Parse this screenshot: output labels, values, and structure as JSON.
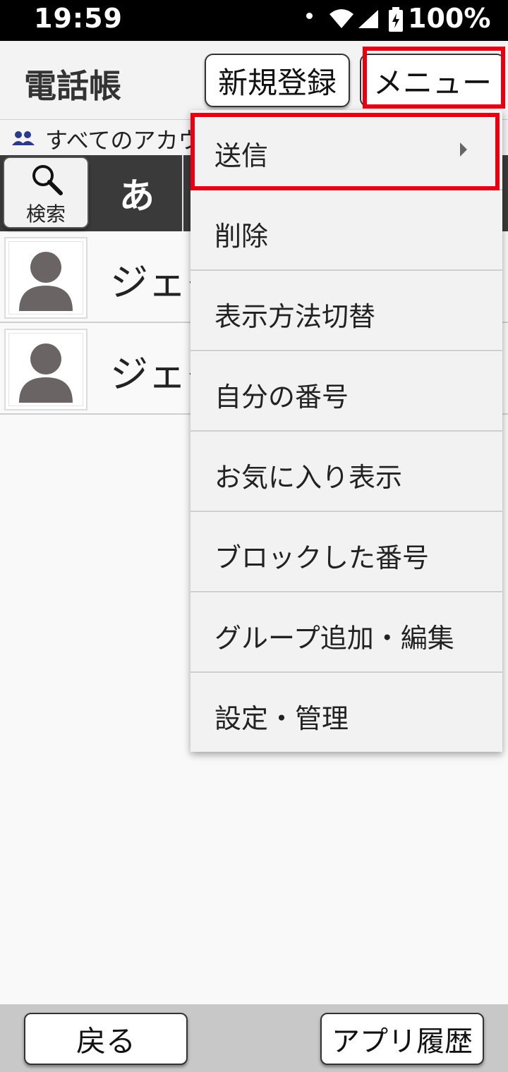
{
  "status": {
    "time": "19:59",
    "battery": "100%"
  },
  "header": {
    "title": "電話帳",
    "new_button": "新規登録",
    "menu_button": "メニュー"
  },
  "account": {
    "label": "すべてのアカウ"
  },
  "index": {
    "search_label": "検索",
    "active_letter": "あ"
  },
  "contacts": [
    {
      "name": "ジェイ"
    },
    {
      "name": "ジェイ"
    }
  ],
  "menu": {
    "items": [
      {
        "label": "送信",
        "has_submenu": true
      },
      {
        "label": "削除"
      },
      {
        "label": "表示方法切替"
      },
      {
        "label": "自分の番号"
      },
      {
        "label": "お気に入り表示"
      },
      {
        "label": "ブロックした番号"
      },
      {
        "label": "グループ追加・編集"
      },
      {
        "label": "設定・管理"
      }
    ]
  },
  "bottom": {
    "back_button": "戻る",
    "history_button": "アプリ履歴"
  },
  "colors": {
    "highlight": "#e60012",
    "index_bg": "#3a3a3a",
    "accent_icon": "#2a3a8c"
  }
}
